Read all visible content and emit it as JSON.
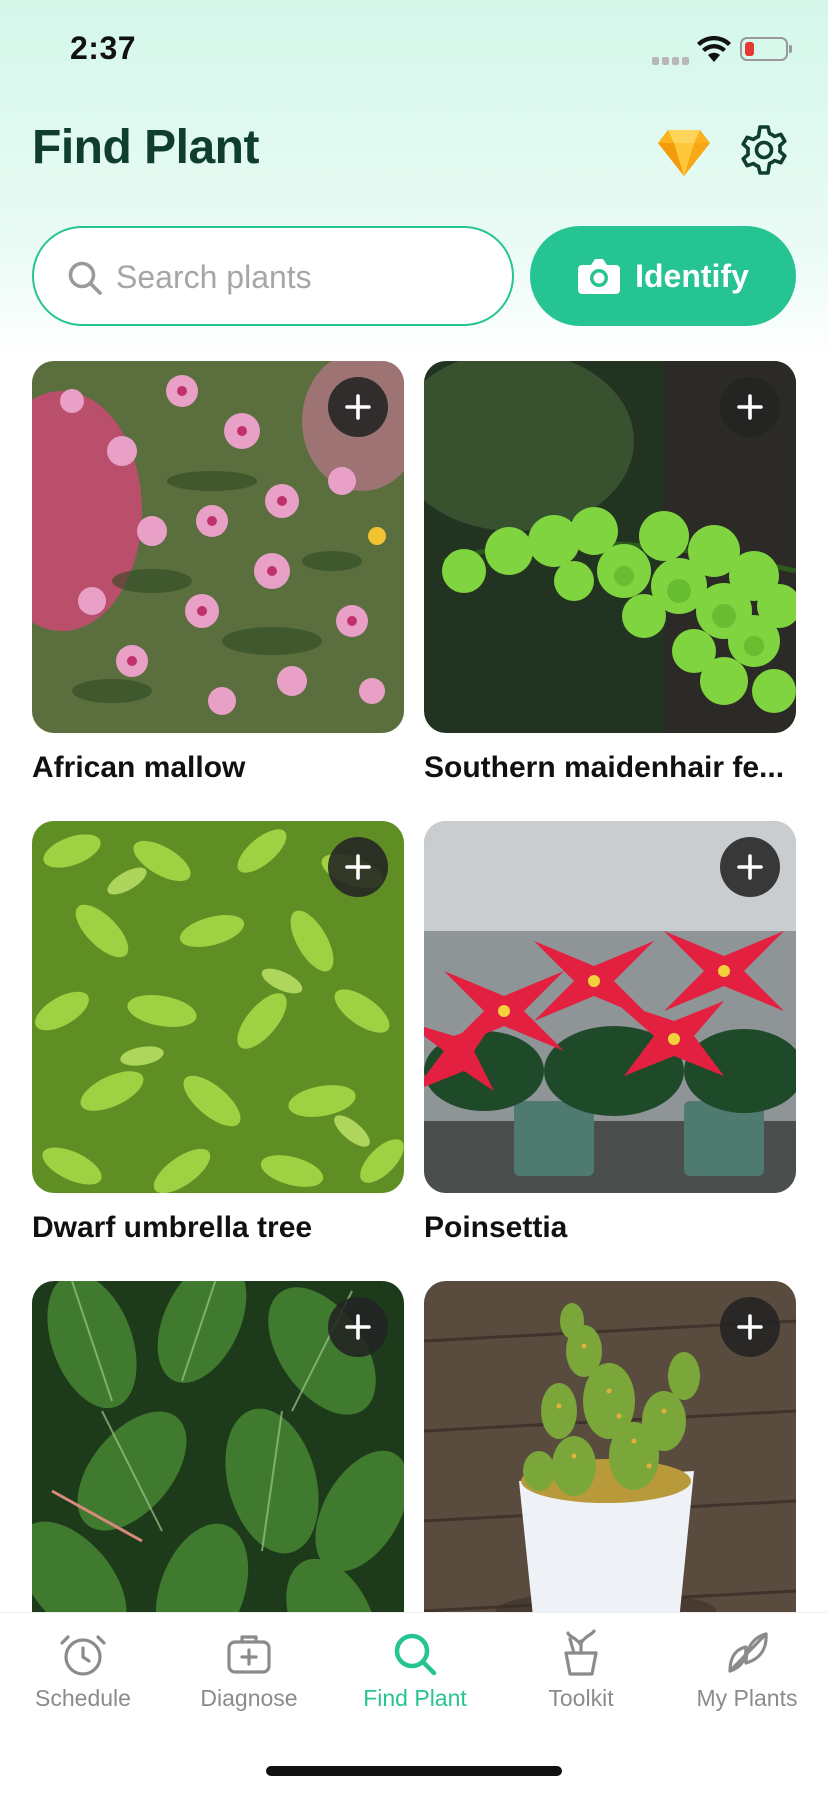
{
  "status_bar": {
    "time": "2:37"
  },
  "header": {
    "title": "Find Plant"
  },
  "search": {
    "placeholder": "Search plants",
    "value": ""
  },
  "identify": {
    "label": "Identify"
  },
  "plants": [
    {
      "name": "African mallow"
    },
    {
      "name": "Southern maidenhair fe..."
    },
    {
      "name": "Dwarf umbrella tree"
    },
    {
      "name": "Poinsettia"
    },
    {
      "name": ""
    },
    {
      "name": ""
    }
  ],
  "tabs": [
    {
      "label": "Schedule",
      "icon": "alarm-clock-icon"
    },
    {
      "label": "Diagnose",
      "icon": "first-aid-kit-icon"
    },
    {
      "label": "Find Plant",
      "icon": "search-icon",
      "active": true
    },
    {
      "label": "Toolkit",
      "icon": "plant-pot-icon"
    },
    {
      "label": "My Plants",
      "icon": "leaves-icon"
    }
  ],
  "colors": {
    "accent": "#27c493",
    "title": "#0f3d30",
    "battery_low": "#e53935"
  }
}
